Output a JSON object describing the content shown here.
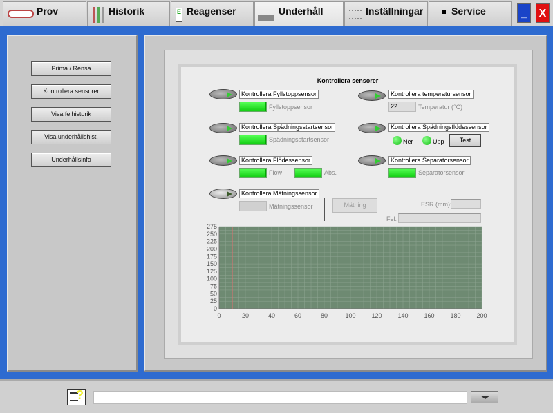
{
  "tabs": [
    {
      "label": "Prov",
      "icon": "sample-tube-icon"
    },
    {
      "label": "Historik",
      "icon": "history-tubes-icon"
    },
    {
      "label": "Reagenser",
      "icon": "reagent-bottle-icon"
    },
    {
      "label": "Underhåll",
      "icon": "maintenance-icon",
      "active": true
    },
    {
      "label": "Inställningar",
      "icon": "settings-list-icon"
    },
    {
      "label": "Service",
      "icon": "service-icon"
    }
  ],
  "window": {
    "minimize": "_",
    "close": "X"
  },
  "sidebar": {
    "items": [
      {
        "label": "Prima / Rensa"
      },
      {
        "label": "Kontrollera sensorer"
      },
      {
        "label": "Visa felhistorik"
      },
      {
        "label": "Visa underhållshist."
      },
      {
        "label": "Underhållsinfo"
      }
    ]
  },
  "main": {
    "title": "Kontrollera sensorer",
    "fill": {
      "toggle": "Kontrollera Fyllstoppsensor",
      "indicator": "Fyllstoppsensor"
    },
    "dilstart": {
      "toggle": "Kontrollera Spädningsstartsensor",
      "indicator": "Spädningsstartsensor"
    },
    "flow": {
      "toggle": "Kontrollera Flödessensor",
      "indicator1": "Flow",
      "indicator2": "Abs."
    },
    "measure": {
      "toggle": "Kontrollera Mätningssensor",
      "indicator": "Mätningssensor",
      "button": "Mätning",
      "esr_label": "ESR (mm):",
      "esr_value": "",
      "error_label": "Fel:",
      "error_value": ""
    },
    "temp": {
      "toggle": "Kontrollera temperatursensor",
      "value": "22",
      "label": "Temperatur (°C)"
    },
    "dilflow": {
      "toggle": "Kontrollera Spädningsflödessensor",
      "down": "Ner",
      "up": "Upp",
      "test": "Test"
    },
    "sep": {
      "toggle": "Kontrollera Separatorsensor",
      "indicator": "Separatorsensor"
    }
  },
  "chart_data": {
    "type": "line",
    "series": [],
    "xlim": [
      0,
      200
    ],
    "ylim": [
      0,
      275
    ],
    "xticks": [
      0,
      20,
      40,
      60,
      80,
      100,
      120,
      140,
      160,
      180,
      200
    ],
    "yticks": [
      0,
      25,
      50,
      75,
      100,
      125,
      150,
      175,
      200,
      225,
      250,
      275
    ],
    "cursor_x": 10,
    "grid": true,
    "plot_bg": "#6e8a72",
    "cursor_color": "#e07070"
  },
  "statusbar": {
    "message": "",
    "help_icon": "help-note-icon",
    "dropdown_icon": "triangle-down-icon"
  }
}
